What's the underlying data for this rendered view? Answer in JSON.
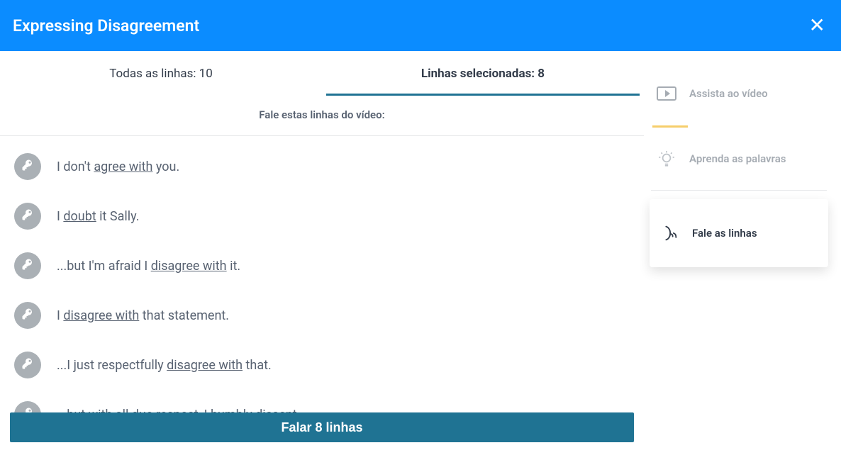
{
  "header": {
    "title": "Expressing Disagreement"
  },
  "tabs": {
    "all_label": "Todas as linhas: 10",
    "selected_label": "Linhas selecionadas: 8",
    "active": "selected"
  },
  "instruction": "Fale estas linhas do vídeo:",
  "lines": [
    {
      "parts": [
        "I don't ",
        {
          "kw": "agree with"
        },
        " you."
      ]
    },
    {
      "parts": [
        "I ",
        {
          "kw": "doubt"
        },
        " it Sally."
      ]
    },
    {
      "parts": [
        "...but I'm afraid I ",
        {
          "kw": "disagree with"
        },
        " it."
      ]
    },
    {
      "parts": [
        "I ",
        {
          "kw": "disagree with"
        },
        " that statement."
      ]
    },
    {
      "parts": [
        "...I just respectfully ",
        {
          "kw": "disagree with"
        },
        " that."
      ]
    },
    {
      "parts": [
        "...but ",
        {
          "kw": "with all due respect"
        },
        ", I humbly ",
        {
          "kw": "dissent"
        },
        "."
      ]
    }
  ],
  "action_button": "Falar 8 linhas",
  "sidebar": {
    "watch": "Assista ao vídeo",
    "learn": "Aprenda as palavras",
    "speak": "Fale as linhas"
  }
}
